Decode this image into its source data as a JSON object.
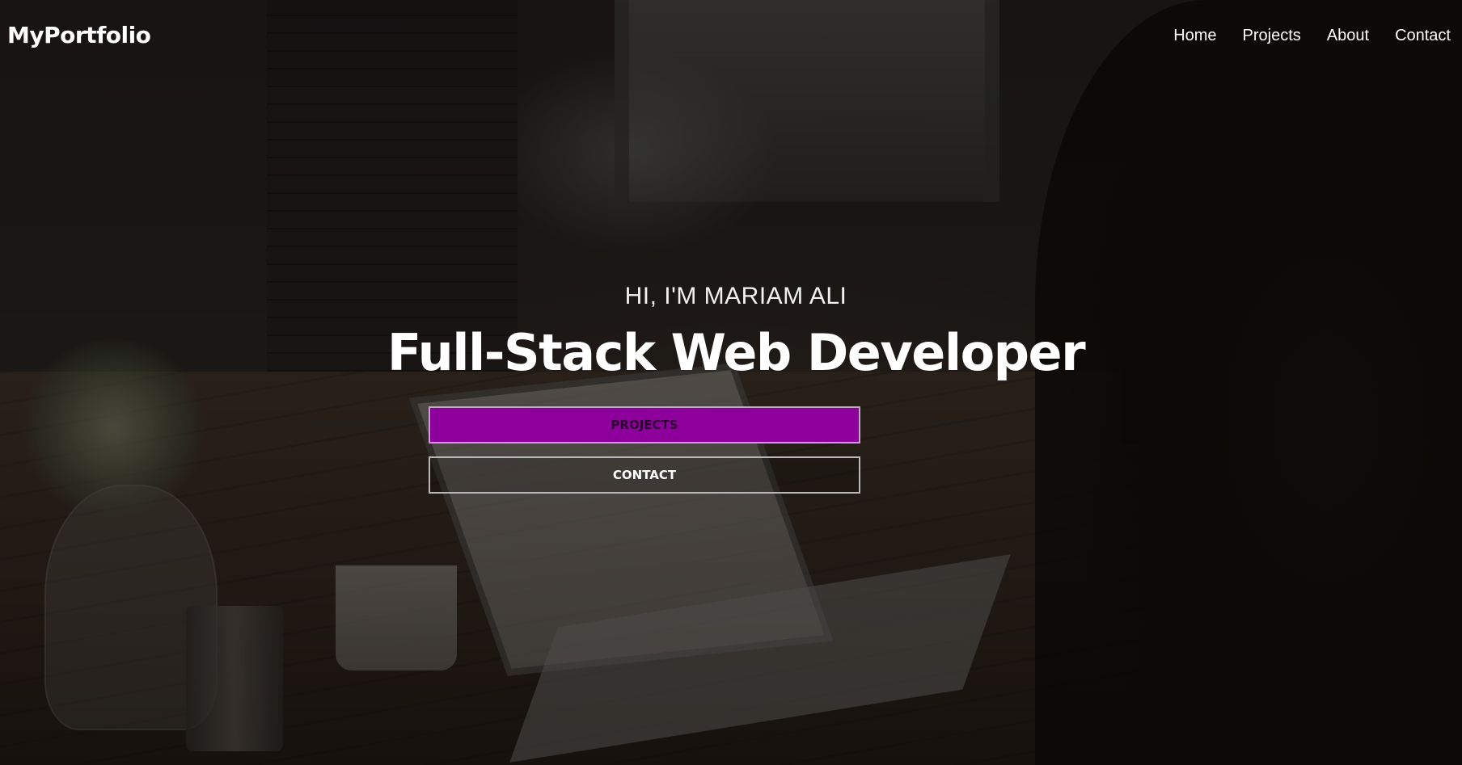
{
  "navbar": {
    "brand": "MyPortfolio",
    "links": [
      "Home",
      "Projects",
      "About",
      "Contact"
    ]
  },
  "hero": {
    "intro": "HI, I'M MARIAM ALI",
    "headline": "Full-Stack Web Developer",
    "buttons": {
      "projects": "PROJECTS",
      "contact": "CONTACT"
    }
  },
  "colors": {
    "accent": "#8e009c",
    "text": "#ffffff"
  }
}
